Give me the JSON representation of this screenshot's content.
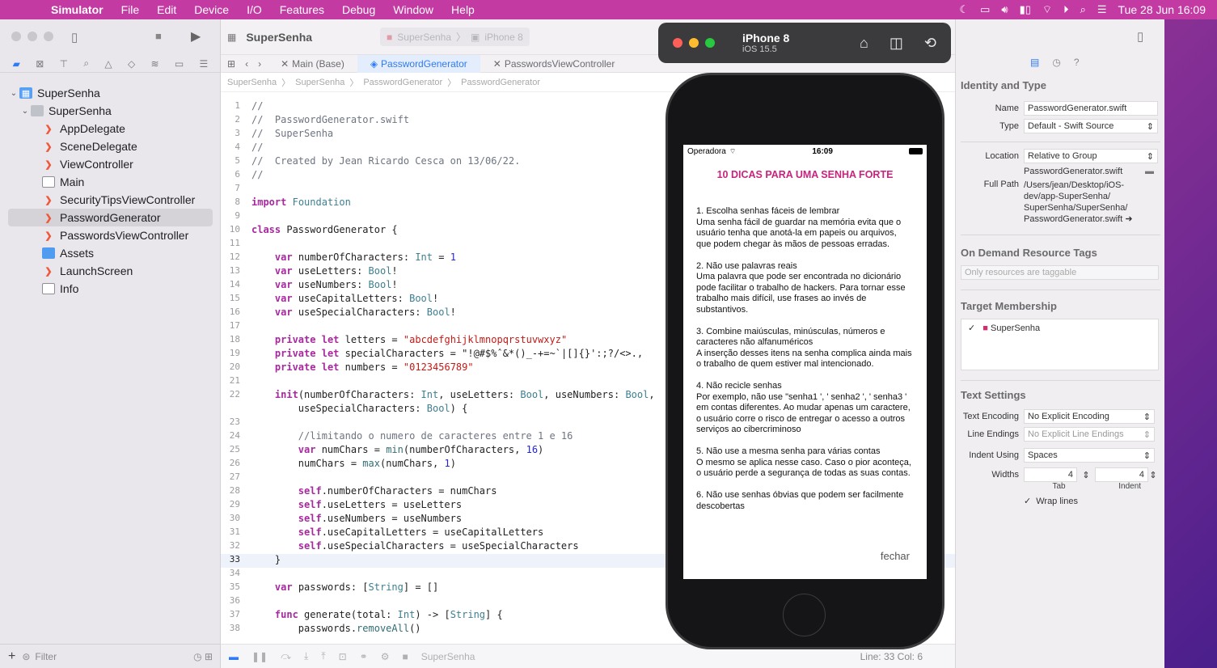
{
  "menubar": {
    "app": "Simulator",
    "items": [
      "File",
      "Edit",
      "Device",
      "I/O",
      "Features",
      "Debug",
      "Window",
      "Help"
    ],
    "clock": "Tue 28 Jun  16:09"
  },
  "toolbar": {
    "project_title": "SuperSenha",
    "scheme": "SuperSenha",
    "destination": "iPhone 8"
  },
  "tabs": [
    {
      "label": "Main (Base)",
      "active": false
    },
    {
      "label": "PasswordGenerator",
      "active": true
    },
    {
      "label": "PasswordsViewController",
      "active": false
    }
  ],
  "breadcrumb": [
    "SuperSenha",
    "SuperSenha",
    "PasswordGenerator",
    "PasswordGenerator"
  ],
  "navigator": {
    "items": [
      {
        "label": "SuperSenha",
        "level": 0,
        "kind": "project"
      },
      {
        "label": "SuperSenha",
        "level": 1,
        "kind": "folder"
      },
      {
        "label": "AppDelegate",
        "level": 2,
        "kind": "swift"
      },
      {
        "label": "SceneDelegate",
        "level": 2,
        "kind": "swift"
      },
      {
        "label": "ViewController",
        "level": 2,
        "kind": "swift"
      },
      {
        "label": "Main",
        "level": 2,
        "kind": "doc"
      },
      {
        "label": "SecurityTipsViewController",
        "level": 2,
        "kind": "swift"
      },
      {
        "label": "PasswordGenerator",
        "level": 2,
        "kind": "swift",
        "selected": true
      },
      {
        "label": "PasswordsViewController",
        "level": 2,
        "kind": "swift"
      },
      {
        "label": "Assets",
        "level": 2,
        "kind": "assets"
      },
      {
        "label": "LaunchScreen",
        "level": 2,
        "kind": "swift"
      },
      {
        "label": "Info",
        "level": 2,
        "kind": "doc"
      }
    ],
    "filter_placeholder": "Filter"
  },
  "code": {
    "current_line": 33,
    "lines": [
      "//",
      "//  PasswordGenerator.swift",
      "//  SuperSenha",
      "//",
      "//  Created by Jean Ricardo Cesca on 13/06/22.",
      "//",
      "",
      "import Foundation",
      "",
      "class PasswordGenerator {",
      "",
      "    var numberOfCharacters: Int = 1",
      "    var useLetters: Bool!",
      "    var useNumbers: Bool!",
      "    var useCapitalLetters: Bool!",
      "    var useSpecialCharacters: Bool!",
      "",
      "    private let letters = \"abcdefghijklmnopqrstuvwxyz\"",
      "    private let specialCharacters = \"!@#$%ˆ&*()_-+=~`|[]{}':;?/<>.,",
      "    private let numbers = \"0123456789\"",
      "",
      "    init(numberOfCharacters: Int, useLetters: Bool, useNumbers: Bool,",
      "        useSpecialCharacters: Bool) {",
      "",
      "        //limitando o numero de caracteres entre 1 e 16",
      "        var numChars = min(numberOfCharacters, 16)",
      "        numChars = max(numChars, 1)",
      "",
      "        self.numberOfCharacters = numChars",
      "        self.useLetters = useLetters",
      "        self.useNumbers = useNumbers",
      "        self.useCapitalLetters = useCapitalLetters",
      "        self.useSpecialCharacters = useSpecialCharacters",
      "    }",
      "",
      "    var passwords: [String] = []",
      "",
      "    func generate(total: Int) -> [String] {",
      "        passwords.removeAll()"
    ],
    "line_numbers": [
      "1",
      "2",
      "3",
      "4",
      "5",
      "6",
      "7",
      "8",
      "9",
      "10",
      "11",
      "12",
      "13",
      "14",
      "15",
      "16",
      "17",
      "18",
      "19",
      "20",
      "21",
      "22",
      "",
      "23",
      "24",
      "25",
      "26",
      "27",
      "28",
      "29",
      "30",
      "31",
      "32",
      "33",
      "34",
      "35",
      "36",
      "37",
      "38"
    ]
  },
  "editor_status": {
    "scheme": "SuperSenha",
    "position": "Line: 33  Col: 6"
  },
  "inspector": {
    "identity_title": "Identity and Type",
    "name_label": "Name",
    "name_value": "PasswordGenerator.swift",
    "type_label": "Type",
    "type_value": "Default - Swift Source",
    "location_label": "Location",
    "location_value": "Relative to Group",
    "location_file": "PasswordGenerator.swift",
    "fullpath_label": "Full Path",
    "fullpath_value": [
      "/Users/jean/Desktop/iOS-",
      "dev/app-SuperSenha/",
      "SuperSenha/SuperSenha/",
      "PasswordGenerator.swift"
    ],
    "tags_title": "On Demand Resource Tags",
    "tags_placeholder": "Only resources are taggable",
    "target_title": "Target Membership",
    "target_name": "SuperSenha",
    "text_title": "Text Settings",
    "encoding_label": "Text Encoding",
    "encoding_value": "No Explicit Encoding",
    "endings_label": "Line Endings",
    "endings_value": "No Explicit Line Endings",
    "indent_label": "Indent Using",
    "indent_value": "Spaces",
    "widths_label": "Widths",
    "tab_value": "4",
    "indent_width_value": "4",
    "tab_caption": "Tab",
    "indent_caption": "Indent",
    "wrap_label": "Wrap lines"
  },
  "simulator": {
    "device": "iPhone 8",
    "os": "iOS 15.5",
    "carrier": "Operadora",
    "time": "16:09",
    "tips_title": "10 DICAS PARA UMA SENHA FORTE",
    "tips": [
      "1. Escolha senhas fáceis de lembrar\nUma senha fácil de guardar na memória evita que o usuário tenha que anotá-la em papeis ou arquivos, que podem chegar às mãos de pessoas erradas.",
      "2. Não use palavras reais\nUma palavra que pode ser encontrada no dicionário pode facilitar o trabalho de hackers. Para tornar esse trabalho mais difícil, use frases ao invés de substantivos.",
      "3.  Combine maiúsculas, minúsculas, números e caracteres não alfanuméricos\nA inserção desses itens na senha complica ainda mais o trabalho de quem estiver mal intencionado.",
      "4.  Não recicle senhas\nPor exemplo, não use \"senha1 ', ' senha2 ', ' senha3 ' em contas diferentes. Ao mudar apenas um caractere, o usuário corre o risco de entregar o acesso a outros serviços ao cibercriminoso",
      "5. Não use a mesma senha para várias contas\nO mesmo se aplica nesse caso. Caso o pior aconteça, o usuário perde a segurança de todas as suas contas.",
      "6.   Não use senhas óbvias que podem ser facilmente descobertas"
    ],
    "close_label": "fechar"
  }
}
